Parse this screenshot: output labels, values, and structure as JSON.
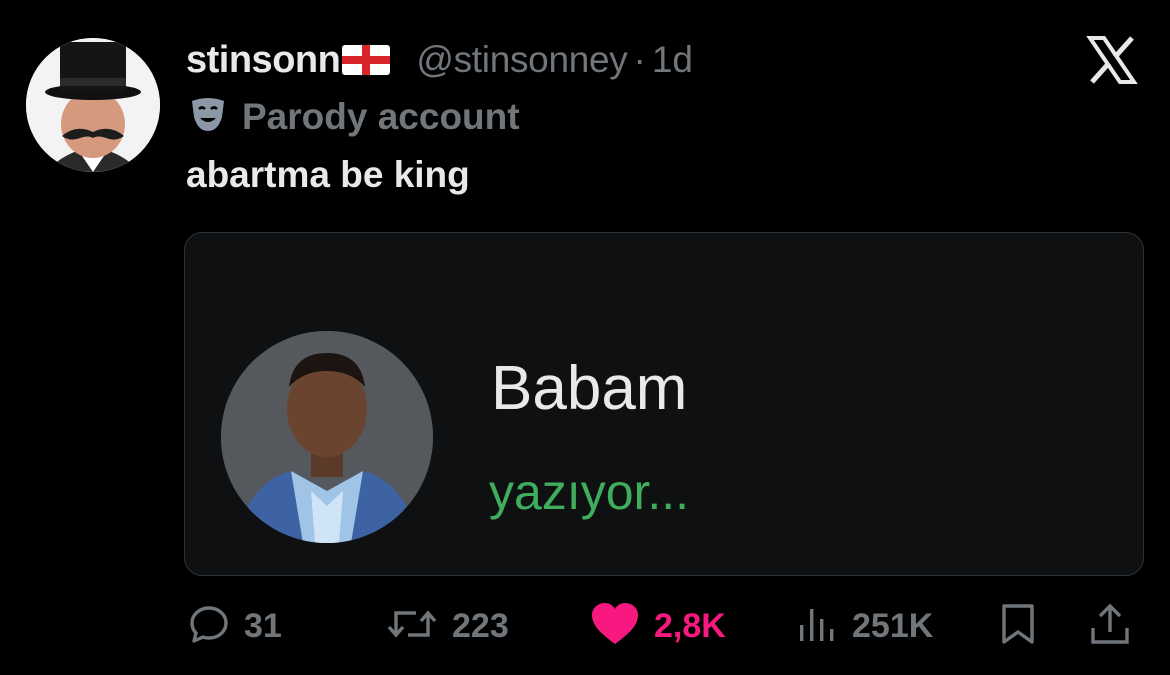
{
  "tweet": {
    "display_name": "stinsonn",
    "flag_icon": "england-flag-icon",
    "handle": "@stinsonney",
    "separator": "·",
    "time": "1d",
    "parody_label": "Parody account",
    "parody_icon": "theater-mask-icon",
    "text": "abartma be king"
  },
  "card": {
    "name": "Babam",
    "status": "yazıyor..."
  },
  "actions": {
    "replies": "31",
    "reposts": "223",
    "likes": "2,8K",
    "views": "251K"
  },
  "colors": {
    "background": "#000000",
    "text": "#e7e9ea",
    "muted": "#71767b",
    "like": "#f91880",
    "typing_green": "#3fad5c",
    "card_bg": "#0f1012"
  }
}
